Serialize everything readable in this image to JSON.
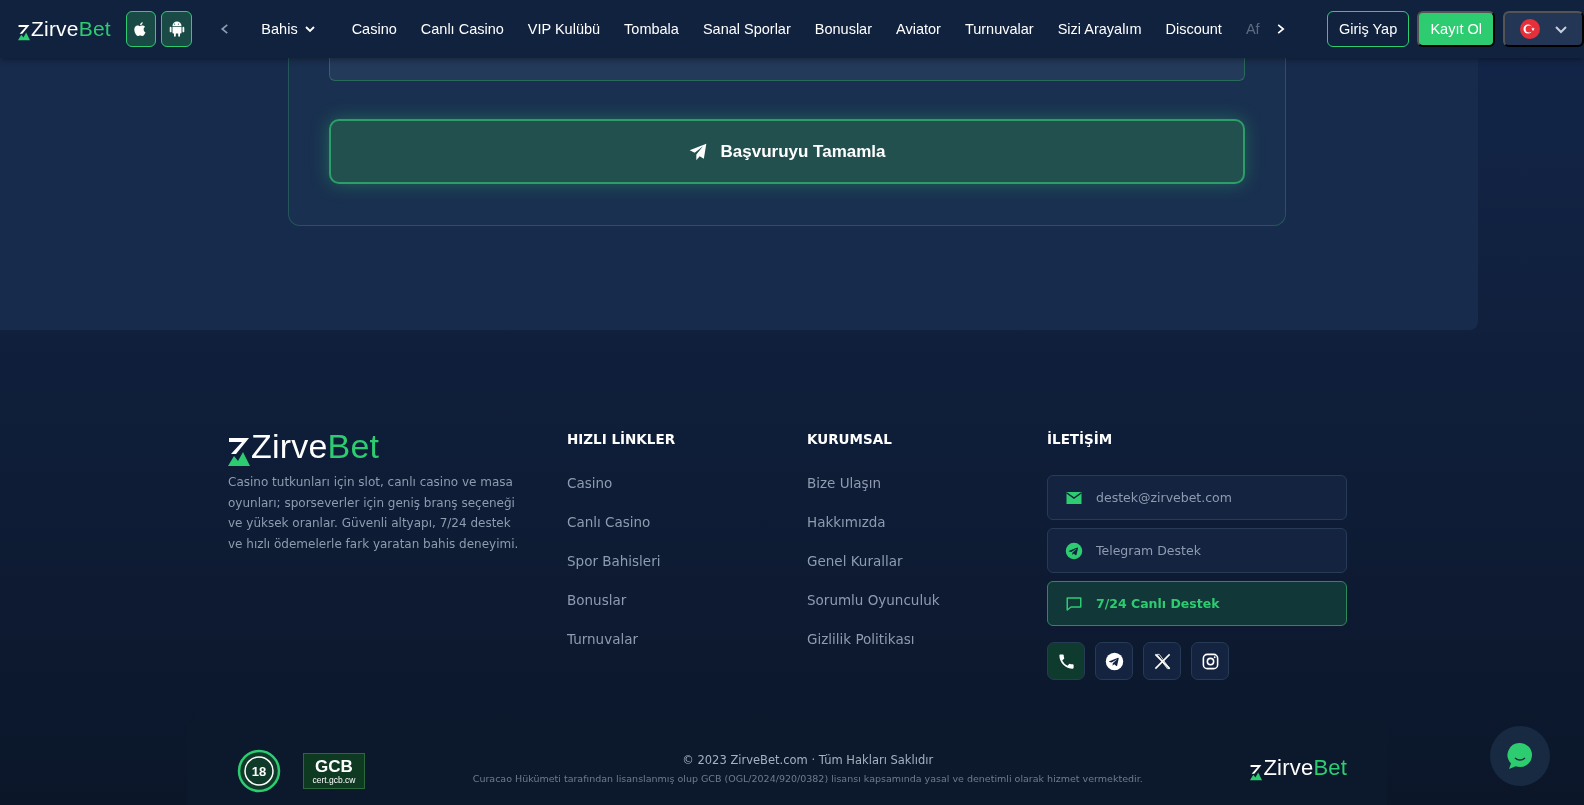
{
  "header": {
    "logo": {
      "first": "Zirve",
      "second": "Bet"
    },
    "apps": [
      {
        "kind": "apple"
      },
      {
        "kind": "android"
      }
    ],
    "nav": [
      {
        "label": "Bahis",
        "kind": "dropdown"
      },
      {
        "label": "Casino",
        "kind": "link"
      },
      {
        "label": "Canlı Casino",
        "kind": "link"
      },
      {
        "label": "VIP Kulübü",
        "kind": "link"
      },
      {
        "label": "Tombala",
        "kind": "link"
      },
      {
        "label": "Sanal Sporlar",
        "kind": "link"
      },
      {
        "label": "Bonuslar",
        "kind": "link"
      },
      {
        "label": "Aviator",
        "kind": "link"
      },
      {
        "label": "Turnuvalar",
        "kind": "link"
      },
      {
        "label": "Sizi Arayalım",
        "kind": "link"
      },
      {
        "label": "Discount",
        "kind": "link"
      },
      {
        "label": "Af",
        "kind": "clipped"
      }
    ],
    "login": "Giriş Yap",
    "register": "Kayıt Ol"
  },
  "form": {
    "submit": "Başvuruyu Tamamla"
  },
  "footer": {
    "logo": {
      "first": "Zirve",
      "second": "Bet"
    },
    "about": "Casino tutkunları için slot, canlı casino ve masa oyunları; sporseverler için geniş branş seçeneği ve yüksek oranlar. Güvenli altyapı, 7/24 destek ve hızlı ödemelerle fark yaratan bahis deneyimi.",
    "columns": [
      {
        "heading": "HIZLI LİNKLER",
        "links": [
          "Casino",
          "Canlı Casino",
          "Spor Bahisleri",
          "Bonuslar",
          "Turnuvalar"
        ]
      },
      {
        "heading": "KURUMSAL",
        "links": [
          "Bize Ulaşın",
          "Hakkımızda",
          "Genel Kurallar",
          "Sorumlu Oyunculuk",
          "Gizlilik Politikası"
        ]
      }
    ],
    "contact": {
      "heading": "İLETİŞİM",
      "items": [
        {
          "kind": "email",
          "label": "destek@zirvebet.com",
          "highlighted": false
        },
        {
          "kind": "telegram",
          "label": "Telegram Destek",
          "highlighted": false
        },
        {
          "kind": "chat",
          "label": "7/24 Canlı Destek",
          "highlighted": true
        }
      ],
      "socials": [
        {
          "kind": "phone",
          "highlighted": true
        },
        {
          "kind": "telegram",
          "highlighted": false
        },
        {
          "kind": "x",
          "highlighted": false
        },
        {
          "kind": "instagram",
          "highlighted": false
        }
      ]
    }
  },
  "bottom_bar": {
    "age_badge": "18",
    "license_badge": {
      "title": "GCB",
      "subtitle": "cert.gcb.cw"
    },
    "copyright": "© 2023 ZirveBet.com · Tüm Hakları Saklıdır",
    "license_text": "Curacao Hükümeti tarafından lisanslanmış olup GCB (OGL/2024/920/0382) lisansı kapsamında yasal ve denetimli olarak hizmet vermektedir.",
    "logo": {
      "first": "Zirve",
      "second": "Bet"
    }
  }
}
